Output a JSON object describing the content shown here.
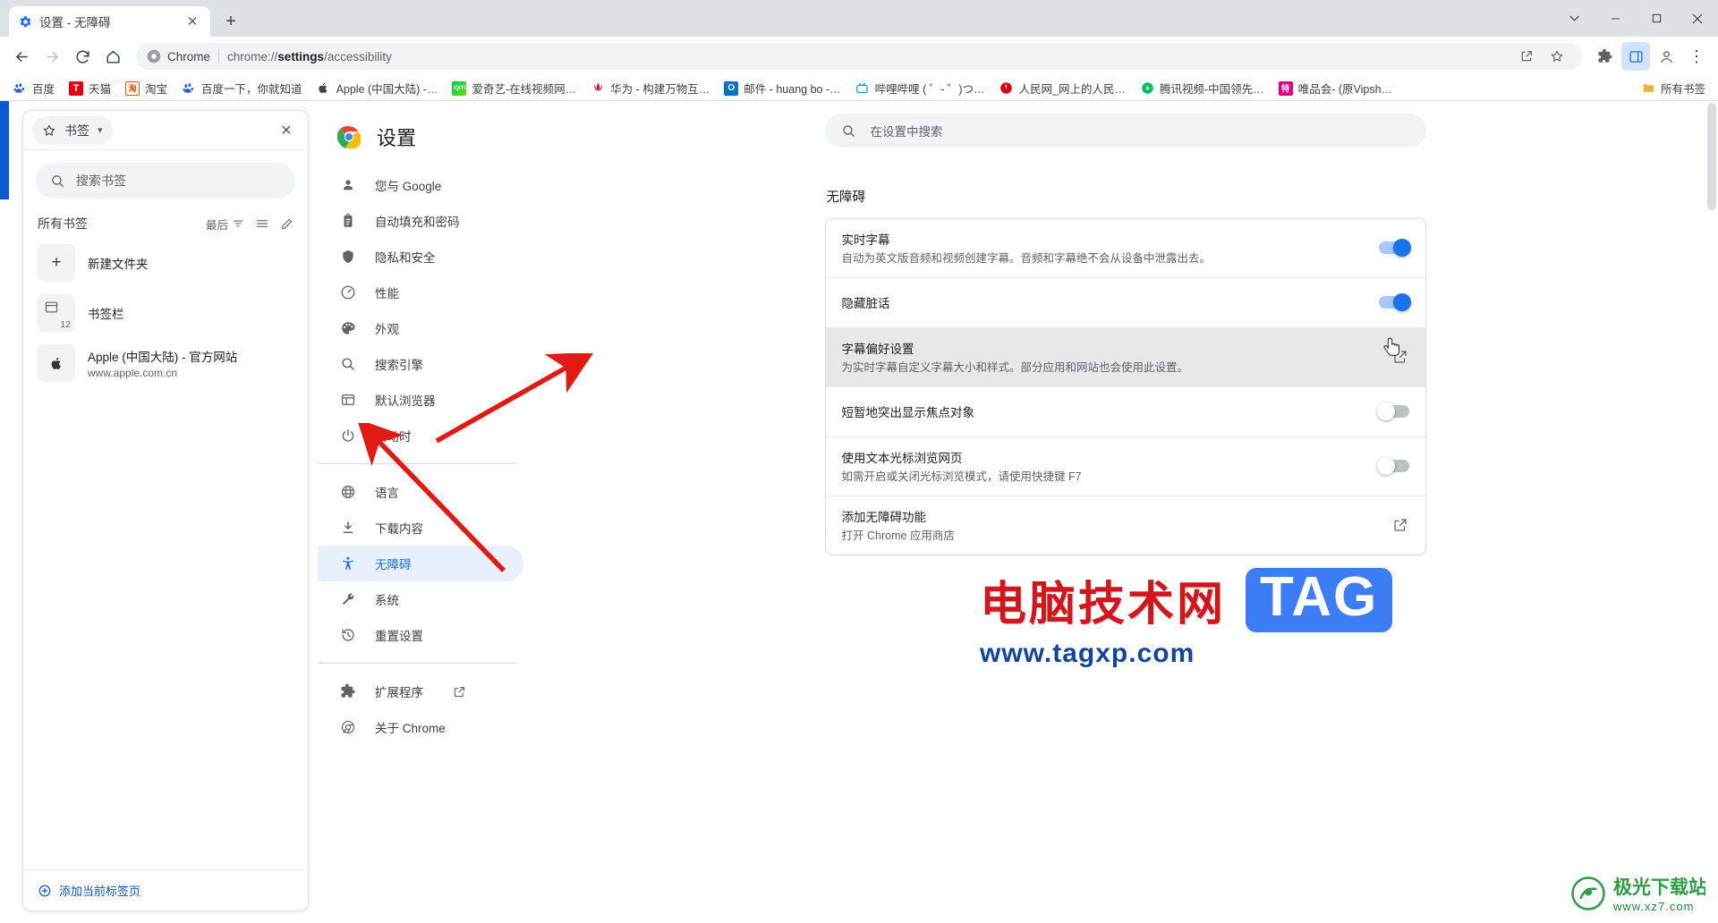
{
  "window": {
    "tab_title": "设置 - 无障碍",
    "tab_close": "✕",
    "new_tab": "+",
    "minimize": "—",
    "maximize": "▢",
    "close": "✕",
    "tablist_chevron": "⌄"
  },
  "toolbar": {
    "back": "←",
    "forward": "→",
    "reload": "⟳",
    "home": "⌂",
    "omnibox_chip": "Chrome",
    "omnibox_url_prefix": "chrome://",
    "omnibox_url_bold": "settings",
    "omnibox_url_suffix": "/accessibility",
    "share": "share-icon",
    "bookmark_star": "☆",
    "extensions": "extensions-icon",
    "sidepanel": "side-panel-icon",
    "profile": "profile-icon",
    "menu": "⋮"
  },
  "bookmarks_bar": {
    "items": [
      {
        "label": "百度",
        "icon_text": "du",
        "icon_color": "#ffffff",
        "icon_fg": "#2b5fd9"
      },
      {
        "label": "天猫",
        "icon_text": "T",
        "icon_color": "#e60012",
        "icon_fg": "#ffffff"
      },
      {
        "label": "淘宝",
        "icon_text": "淘",
        "icon_color": "#ff5000",
        "icon_fg": "#ffffff"
      },
      {
        "label": "百度一下，你就知道",
        "icon_text": "du",
        "icon_color": "#ffffff",
        "icon_fg": "#2b5fd9"
      },
      {
        "label": "Apple (中国大陆) -…",
        "icon_text": "",
        "icon_color": "#ffffff",
        "icon_fg": "#333333"
      },
      {
        "label": "爱奇艺-在线视频网…",
        "icon_text": "iQIYI",
        "icon_color": "#00be06",
        "icon_fg": "#ffffff"
      },
      {
        "label": "华为 - 构建万物互…",
        "icon_text": "",
        "icon_color": "#ffffff",
        "icon_fg": "#cf0a2c"
      },
      {
        "label": "邮件 - huang bo -…",
        "icon_text": "O",
        "icon_color": "#0072c6",
        "icon_fg": "#ffffff"
      },
      {
        "label": "哔哩哔哩 ( ゜- ゜)つ…",
        "icon_text": "",
        "icon_color": "#ffffff",
        "icon_fg": "#00a1d6"
      },
      {
        "label": "人民网_网上的人民…",
        "icon_text": "",
        "icon_color": "#ffffff",
        "icon_fg": "#d7000f"
      },
      {
        "label": "腾讯视频-中国领先…",
        "icon_text": "▶",
        "icon_color": "#ffffff",
        "icon_fg": "#00c05a"
      },
      {
        "label": "唯品会- (原Vipsh…",
        "icon_text": "特",
        "icon_color": "#e10082",
        "icon_fg": "#ffffff"
      }
    ],
    "all_bookmarks_label": "所有书签",
    "all_bookmarks_icon": "folder-icon"
  },
  "side_panel": {
    "combo_label": "书签",
    "combo_icon": "star-icon",
    "combo_chevron": "▾",
    "close_icon": "✕",
    "search_placeholder": "搜索书签",
    "search_icon": "search-icon",
    "all_bookmarks_label": "所有书签",
    "sort_label": "最后",
    "sort_icon": "filter-icon",
    "list_view_icon": "list-icon",
    "edit_icon": "pencil-icon",
    "items": [
      {
        "title": "新建文件夹",
        "subtitle": "",
        "thumb_glyph": "+",
        "count": ""
      },
      {
        "title": "书签栏",
        "subtitle": "",
        "thumb_glyph": "folder-icon",
        "count": "12"
      },
      {
        "title": "Apple (中国大陆) - 官方网站",
        "subtitle": "www.apple.com.cn",
        "thumb_glyph": "apple-icon",
        "count": ""
      }
    ],
    "footer_label": "添加当前标签页",
    "footer_icon": "plus-circle-icon"
  },
  "settings": {
    "brand_title": "设置",
    "brand_icon": "chrome-logo",
    "search_placeholder": "在设置中搜索",
    "search_icon": "search-icon",
    "nav_groups": [
      {
        "items": [
          {
            "label": "您与 Google",
            "icon": "person-icon",
            "active": false
          },
          {
            "label": "自动填充和密码",
            "icon": "clipboard-icon",
            "active": false
          },
          {
            "label": "隐私和安全",
            "icon": "shield-icon",
            "active": false
          },
          {
            "label": "性能",
            "icon": "speedometer-icon",
            "active": false
          },
          {
            "label": "外观",
            "icon": "palette-icon",
            "active": false
          },
          {
            "label": "搜索引擎",
            "icon": "search-icon",
            "active": false
          },
          {
            "label": "默认浏览器",
            "icon": "browser-icon",
            "active": false
          },
          {
            "label": "启动时",
            "icon": "power-icon",
            "active": false
          }
        ]
      },
      {
        "items": [
          {
            "label": "语言",
            "icon": "globe-icon",
            "active": false
          },
          {
            "label": "下载内容",
            "icon": "download-icon",
            "active": false
          },
          {
            "label": "无障碍",
            "icon": "accessibility-icon",
            "active": true
          },
          {
            "label": "系统",
            "icon": "wrench-icon",
            "active": false
          },
          {
            "label": "重置设置",
            "icon": "restore-icon",
            "active": false
          }
        ]
      },
      {
        "items": [
          {
            "label": "扩展程序",
            "icon": "puzzle-icon",
            "active": false,
            "external": true
          },
          {
            "label": "关于 Chrome",
            "icon": "chrome-outline-icon",
            "active": false
          }
        ]
      }
    ],
    "section_title": "无障碍",
    "rows": [
      {
        "title": "实时字幕",
        "subtitle": "自动为英文版音频和视频创建字幕。音频和字幕绝不会从设备中泄露出去。",
        "control": "toggle",
        "toggle_on": true,
        "highlight": false
      },
      {
        "title": "隐藏脏话",
        "subtitle": "",
        "control": "toggle",
        "toggle_on": true,
        "highlight": false
      },
      {
        "title": "字幕偏好设置",
        "subtitle": "为实时字幕自定义字幕大小和样式。部分应用和网站也会使用此设置。",
        "control": "external",
        "toggle_on": false,
        "highlight": true
      },
      {
        "title": "短暂地突出显示焦点对象",
        "subtitle": "",
        "control": "toggle",
        "toggle_on": false,
        "highlight": false
      },
      {
        "title": "使用文本光标浏览网页",
        "subtitle": "如需开启或关闭光标浏览模式，请使用快捷键 F7",
        "control": "toggle",
        "toggle_on": false,
        "highlight": false
      },
      {
        "title": "添加无障碍功能",
        "subtitle": "打开 Chrome 应用商店",
        "control": "external",
        "toggle_on": false,
        "highlight": false
      }
    ]
  },
  "watermark": {
    "cn_text": "电脑技术网",
    "tag_text": "TAG",
    "url_text": "www.tagxp.com",
    "corner_name": "极光下载站",
    "corner_url": "www.xz7.com"
  },
  "colors": {
    "accent": "#1a73e8",
    "accent_soft": "#e8f0fe",
    "toggle_on": "#a8c7fa",
    "tabstrip": "#dee1e6",
    "arrow_red": "#e01b14",
    "highlight_row": "#e8e8e8"
  }
}
